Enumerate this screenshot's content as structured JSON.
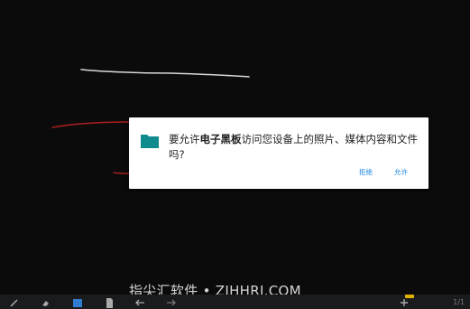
{
  "dialog": {
    "message_prefix": "要允许",
    "app_name": "电子黑板",
    "message_suffix": "访问您设备上的照片、媒体内容和文件吗?",
    "deny_label": "拒绝",
    "allow_label": "允许",
    "icon": "folder-icon",
    "icon_color": "#0f8b8d",
    "button_color": "#1e88e5"
  },
  "watermark": {
    "text": "指尖汇软件 • ZJHHRJ.COM"
  },
  "toolbar": {
    "page_indicator": "1/1",
    "icons": [
      "pen-icon",
      "eraser-icon",
      "select-icon",
      "page-icon",
      "undo-icon",
      "redo-icon",
      "add-page-icon"
    ]
  },
  "canvas": {
    "background": "#0b0b0c",
    "stroke_colors": [
      "#d8d8d8",
      "#a11d1d"
    ]
  }
}
